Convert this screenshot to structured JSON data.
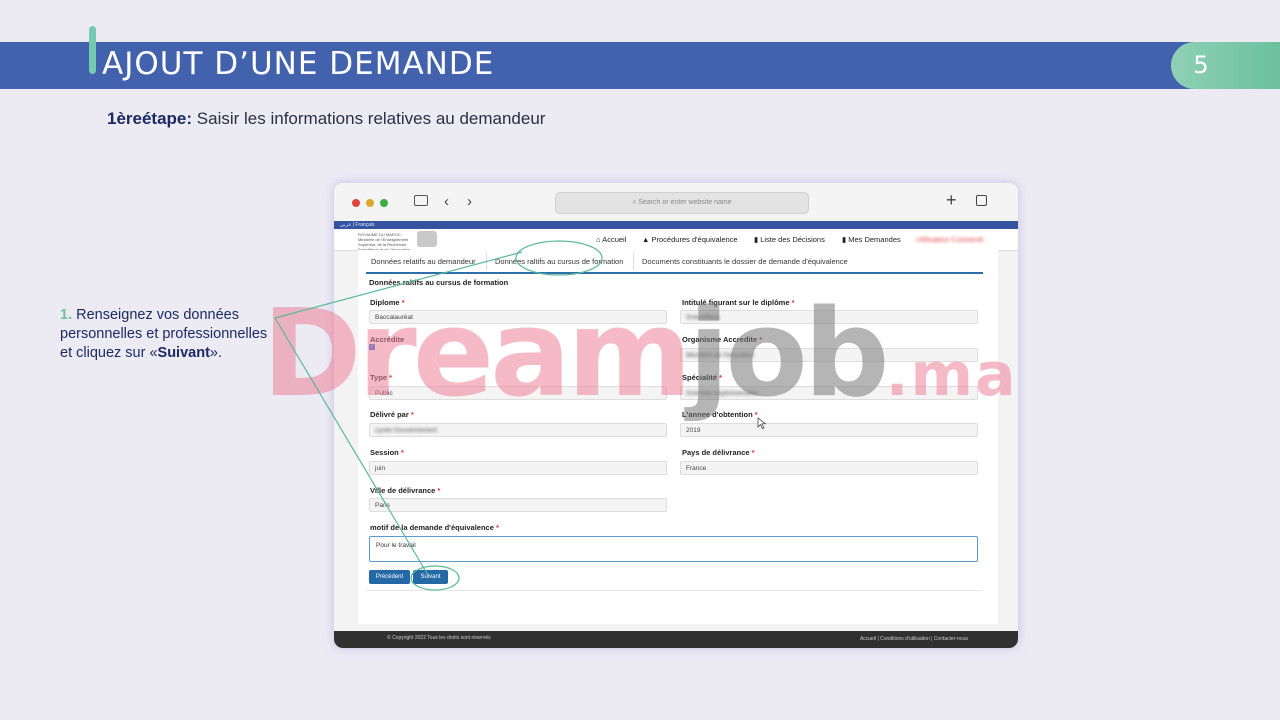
{
  "slide": {
    "title": "AJOUT D’UNE DEMANDE",
    "page_number": "5",
    "step_bold": "1èreétape:",
    "step_text": " Saisir les informations relatives au demandeur",
    "instruction": {
      "num": "1.",
      "text_1": " Renseignez vos données personnelles et professionnelles et cliquez sur «",
      "bold": "Suivant",
      "text_2": "»."
    },
    "watermark": {
      "part1": "Dream",
      "part2": "job",
      "part3": ".ma"
    }
  },
  "browser": {
    "url_placeholder": "Search or enter website name",
    "strip_text": "عربي | Français",
    "logo_text": "ROYAUME DU MAROC · Ministère de l’Enseignement Supérieur, de la Recherche Scientifique et de l’Innovation",
    "nav": {
      "accueil": "Accueil",
      "procedures": "Procédures d'équivalence",
      "decisions": "Liste des Décisions",
      "mes_demandes": "Mes Demandes",
      "user": "Utilisateur Connecté"
    },
    "tabs": [
      "Données relatifs au demandeur",
      "Données raltifs au cursus de formation",
      "Documents constituants le dossier de demande d'équivalence"
    ],
    "section_title": "Données raltifs au cursus de formation",
    "form": {
      "diplome": {
        "label": "Diplome",
        "value": "Baccalauréat"
      },
      "intitule": {
        "label": "Intitulé figurant sur le diplôme",
        "value": "Scientifique"
      },
      "accredite": {
        "label": "Accrédite",
        "checked": true
      },
      "organisme": {
        "label": "Organisme Accredite",
        "value": "Ministère de l'éducation"
      },
      "type": {
        "label": "Type",
        "value": "Public"
      },
      "specialite": {
        "label": "Spécialité",
        "value": "Sciences expérimentales"
      },
      "delivre_par": {
        "label": "Délivré par",
        "value": "Lycée Gouvernement"
      },
      "annee": {
        "label": "L'annee d'obtention",
        "value": "2019"
      },
      "session": {
        "label": "Session",
        "value": "juin"
      },
      "pays": {
        "label": "Pays de délivrance",
        "value": "France"
      },
      "ville": {
        "label": "Ville de délivrance",
        "value": "Paris"
      },
      "motif": {
        "label": "motif de la demande d'équivalence",
        "value": "Pour le travail"
      }
    },
    "buttons": {
      "previous": "Précédent",
      "next": "Suivant"
    },
    "footer": {
      "copyright": "© Copyright 2022 Tous les droits sont réservés",
      "links": "Accueil  |  Conditions d'utilisation  |  Contacter-nous"
    }
  }
}
